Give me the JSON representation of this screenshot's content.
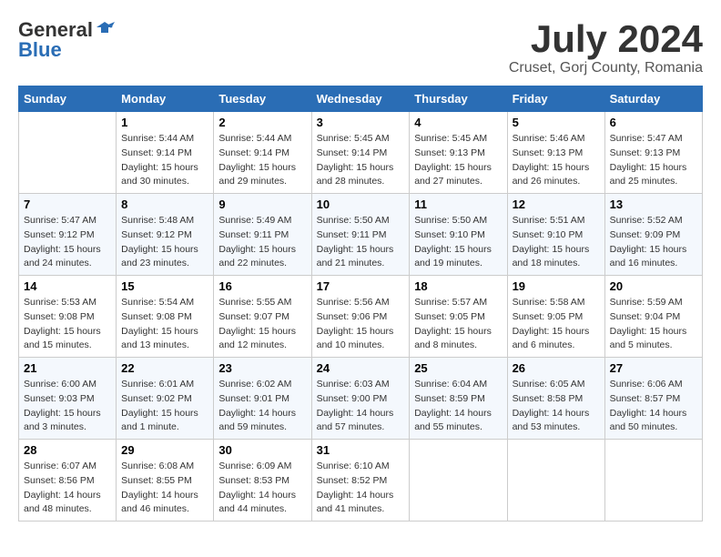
{
  "header": {
    "logo_general": "General",
    "logo_blue": "Blue",
    "month_title": "July 2024",
    "location": "Cruset, Gorj County, Romania"
  },
  "weekdays": [
    "Sunday",
    "Monday",
    "Tuesday",
    "Wednesday",
    "Thursday",
    "Friday",
    "Saturday"
  ],
  "weeks": [
    [
      {
        "day": "",
        "info": ""
      },
      {
        "day": "1",
        "info": "Sunrise: 5:44 AM\nSunset: 9:14 PM\nDaylight: 15 hours\nand 30 minutes."
      },
      {
        "day": "2",
        "info": "Sunrise: 5:44 AM\nSunset: 9:14 PM\nDaylight: 15 hours\nand 29 minutes."
      },
      {
        "day": "3",
        "info": "Sunrise: 5:45 AM\nSunset: 9:14 PM\nDaylight: 15 hours\nand 28 minutes."
      },
      {
        "day": "4",
        "info": "Sunrise: 5:45 AM\nSunset: 9:13 PM\nDaylight: 15 hours\nand 27 minutes."
      },
      {
        "day": "5",
        "info": "Sunrise: 5:46 AM\nSunset: 9:13 PM\nDaylight: 15 hours\nand 26 minutes."
      },
      {
        "day": "6",
        "info": "Sunrise: 5:47 AM\nSunset: 9:13 PM\nDaylight: 15 hours\nand 25 minutes."
      }
    ],
    [
      {
        "day": "7",
        "info": "Sunrise: 5:47 AM\nSunset: 9:12 PM\nDaylight: 15 hours\nand 24 minutes."
      },
      {
        "day": "8",
        "info": "Sunrise: 5:48 AM\nSunset: 9:12 PM\nDaylight: 15 hours\nand 23 minutes."
      },
      {
        "day": "9",
        "info": "Sunrise: 5:49 AM\nSunset: 9:11 PM\nDaylight: 15 hours\nand 22 minutes."
      },
      {
        "day": "10",
        "info": "Sunrise: 5:50 AM\nSunset: 9:11 PM\nDaylight: 15 hours\nand 21 minutes."
      },
      {
        "day": "11",
        "info": "Sunrise: 5:50 AM\nSunset: 9:10 PM\nDaylight: 15 hours\nand 19 minutes."
      },
      {
        "day": "12",
        "info": "Sunrise: 5:51 AM\nSunset: 9:10 PM\nDaylight: 15 hours\nand 18 minutes."
      },
      {
        "day": "13",
        "info": "Sunrise: 5:52 AM\nSunset: 9:09 PM\nDaylight: 15 hours\nand 16 minutes."
      }
    ],
    [
      {
        "day": "14",
        "info": "Sunrise: 5:53 AM\nSunset: 9:08 PM\nDaylight: 15 hours\nand 15 minutes."
      },
      {
        "day": "15",
        "info": "Sunrise: 5:54 AM\nSunset: 9:08 PM\nDaylight: 15 hours\nand 13 minutes."
      },
      {
        "day": "16",
        "info": "Sunrise: 5:55 AM\nSunset: 9:07 PM\nDaylight: 15 hours\nand 12 minutes."
      },
      {
        "day": "17",
        "info": "Sunrise: 5:56 AM\nSunset: 9:06 PM\nDaylight: 15 hours\nand 10 minutes."
      },
      {
        "day": "18",
        "info": "Sunrise: 5:57 AM\nSunset: 9:05 PM\nDaylight: 15 hours\nand 8 minutes."
      },
      {
        "day": "19",
        "info": "Sunrise: 5:58 AM\nSunset: 9:05 PM\nDaylight: 15 hours\nand 6 minutes."
      },
      {
        "day": "20",
        "info": "Sunrise: 5:59 AM\nSunset: 9:04 PM\nDaylight: 15 hours\nand 5 minutes."
      }
    ],
    [
      {
        "day": "21",
        "info": "Sunrise: 6:00 AM\nSunset: 9:03 PM\nDaylight: 15 hours\nand 3 minutes."
      },
      {
        "day": "22",
        "info": "Sunrise: 6:01 AM\nSunset: 9:02 PM\nDaylight: 15 hours\nand 1 minute."
      },
      {
        "day": "23",
        "info": "Sunrise: 6:02 AM\nSunset: 9:01 PM\nDaylight: 14 hours\nand 59 minutes."
      },
      {
        "day": "24",
        "info": "Sunrise: 6:03 AM\nSunset: 9:00 PM\nDaylight: 14 hours\nand 57 minutes."
      },
      {
        "day": "25",
        "info": "Sunrise: 6:04 AM\nSunset: 8:59 PM\nDaylight: 14 hours\nand 55 minutes."
      },
      {
        "day": "26",
        "info": "Sunrise: 6:05 AM\nSunset: 8:58 PM\nDaylight: 14 hours\nand 53 minutes."
      },
      {
        "day": "27",
        "info": "Sunrise: 6:06 AM\nSunset: 8:57 PM\nDaylight: 14 hours\nand 50 minutes."
      }
    ],
    [
      {
        "day": "28",
        "info": "Sunrise: 6:07 AM\nSunset: 8:56 PM\nDaylight: 14 hours\nand 48 minutes."
      },
      {
        "day": "29",
        "info": "Sunrise: 6:08 AM\nSunset: 8:55 PM\nDaylight: 14 hours\nand 46 minutes."
      },
      {
        "day": "30",
        "info": "Sunrise: 6:09 AM\nSunset: 8:53 PM\nDaylight: 14 hours\nand 44 minutes."
      },
      {
        "day": "31",
        "info": "Sunrise: 6:10 AM\nSunset: 8:52 PM\nDaylight: 14 hours\nand 41 minutes."
      },
      {
        "day": "",
        "info": ""
      },
      {
        "day": "",
        "info": ""
      },
      {
        "day": "",
        "info": ""
      }
    ]
  ]
}
